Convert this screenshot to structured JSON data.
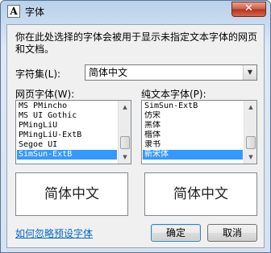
{
  "window": {
    "title": "字体",
    "app_icon_glyph": "A",
    "close_glyph": "✕"
  },
  "description": "你在此处选择的字体会被用于显示未指定文本字体的网页和文档。",
  "charset": {
    "label": "字符集(L):",
    "value": "简体中文"
  },
  "web_font": {
    "label": "网页字体(W):",
    "items": [
      "MS PMincho",
      "MS UI Gothic",
      "PMingLiU",
      "PMingLiU-ExtB",
      "Segoe UI",
      "SimSun-ExtB"
    ],
    "selected": "SimSun-ExtB",
    "preview": "简体中文"
  },
  "plain_font": {
    "label": "纯文本字体(P):",
    "items": [
      "SimSun-ExtB",
      "仿宋",
      "黑体",
      "楷体",
      "隶书",
      "新宋体"
    ],
    "selected": "新宋体",
    "preview": "简体中文"
  },
  "ignore_link": "如何忽略预设字体",
  "ok_label": "确定",
  "cancel_label": "取消"
}
